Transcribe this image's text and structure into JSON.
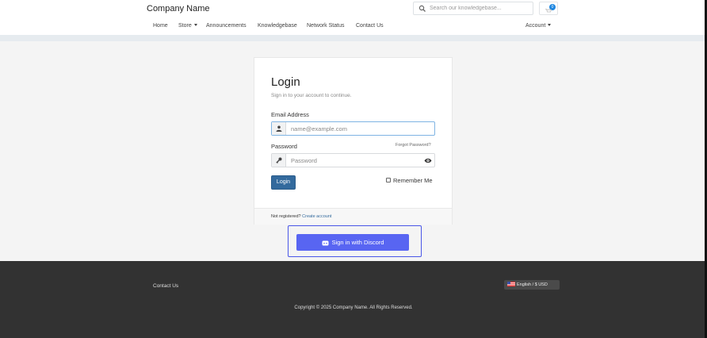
{
  "header": {
    "brand": "Company Name",
    "search_placeholder": "Search our knowledgebase...",
    "cart_count": "0"
  },
  "nav": {
    "items": [
      {
        "label": "Home",
        "dropdown": false
      },
      {
        "label": "Store",
        "dropdown": true
      },
      {
        "label": "Announcements",
        "dropdown": false
      },
      {
        "label": "Knowledgebase",
        "dropdown": false
      },
      {
        "label": "Network Status",
        "dropdown": false
      },
      {
        "label": "Contact Us",
        "dropdown": false
      }
    ],
    "account_label": "Account"
  },
  "login": {
    "title": "Login",
    "subtitle": "Sign in to your account to continue.",
    "email_label": "Email Address",
    "email_placeholder": "name@example.com",
    "password_label": "Password",
    "forgot_label": "Forgot Password?",
    "password_placeholder": "Password",
    "login_button": "Login",
    "remember_label": "Remember Me",
    "footer_prefix": "Not registered?",
    "footer_link": "Create account"
  },
  "discord": {
    "button_label": "Sign in with Discord",
    "color": "#5865f2"
  },
  "footer": {
    "contact": "Contact Us",
    "language": "English / $ USD",
    "copyright": "Copyright © 2025 Company Name. All Rights Reserved."
  },
  "icons": {
    "search": "search-icon",
    "cart": "cart-icon",
    "user": "user-icon",
    "key": "key-icon",
    "eye": "eye-icon",
    "discord": "discord-icon",
    "flag": "us-flag-icon"
  },
  "colors": {
    "primary": "#336a9d",
    "cart_badge": "#1e86e0",
    "footer_bg": "#323232",
    "page_bg": "#f4f4f4"
  }
}
